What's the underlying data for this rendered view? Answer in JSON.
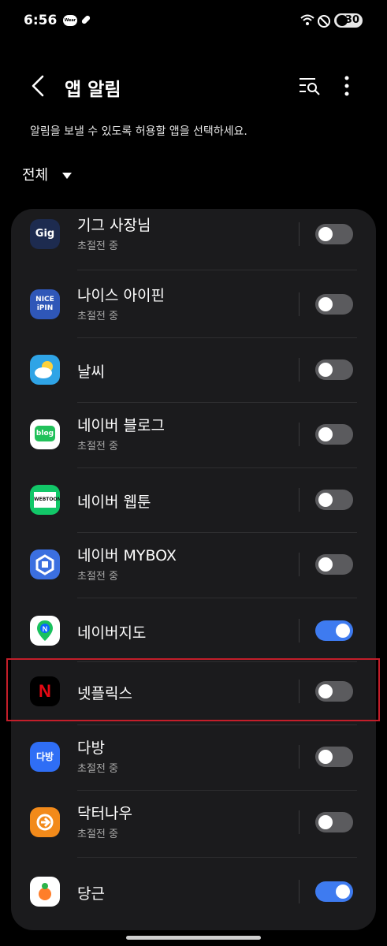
{
  "status": {
    "time": "6:56",
    "wear_label": "Wear",
    "battery": "30"
  },
  "header": {
    "title": "앱 알림"
  },
  "description": "알림을 보낼 수 있도록 허용할 앱을 선택하세요.",
  "filter": {
    "label": "전체"
  },
  "apps": [
    {
      "name": "기그 사장님",
      "subtitle": "초절전 중",
      "enabled": false,
      "icon": "gig-app-icon",
      "icon_text": "Gig",
      "color": "#1d2b4f"
    },
    {
      "name": "나이스 아이핀",
      "subtitle": "초절전 중",
      "enabled": false,
      "icon": "nice-ipin-app-icon",
      "icon_text": "NICE iPIN",
      "color": "#2f57b8"
    },
    {
      "name": "날씨",
      "subtitle": "",
      "enabled": false,
      "icon": "weather-app-icon",
      "icon_text": "",
      "color": "#2fa4e6"
    },
    {
      "name": "네이버 블로그",
      "subtitle": "초절전 중",
      "enabled": false,
      "icon": "naver-blog-app-icon",
      "icon_text": "blog",
      "color": "#ffffff"
    },
    {
      "name": "네이버 웹툰",
      "subtitle": "",
      "enabled": false,
      "icon": "naver-webtoon-app-icon",
      "icon_text": "WEBTOON",
      "color": "#12c768"
    },
    {
      "name": "네이버 MYBOX",
      "subtitle": "초절전 중",
      "enabled": false,
      "icon": "naver-mybox-app-icon",
      "icon_text": "",
      "color": "#3b6fe0"
    },
    {
      "name": "네이버지도",
      "subtitle": "",
      "enabled": true,
      "icon": "naver-map-app-icon",
      "icon_text": "N",
      "color": "#ffffff"
    },
    {
      "name": "넷플릭스",
      "subtitle": "",
      "enabled": false,
      "icon": "netflix-app-icon",
      "icon_text": "N",
      "color": "#000000"
    },
    {
      "name": "다방",
      "subtitle": "초절전 중",
      "enabled": false,
      "icon": "dabang-app-icon",
      "icon_text": "다방",
      "color": "#2f6ef5"
    },
    {
      "name": "닥터나우",
      "subtitle": "초절전 중",
      "enabled": false,
      "icon": "doctornow-app-icon",
      "icon_text": "",
      "color": "#f28a1a"
    },
    {
      "name": "당근",
      "subtitle": "",
      "enabled": true,
      "icon": "daangn-app-icon",
      "icon_text": "",
      "color": "#ffffff"
    }
  ]
}
